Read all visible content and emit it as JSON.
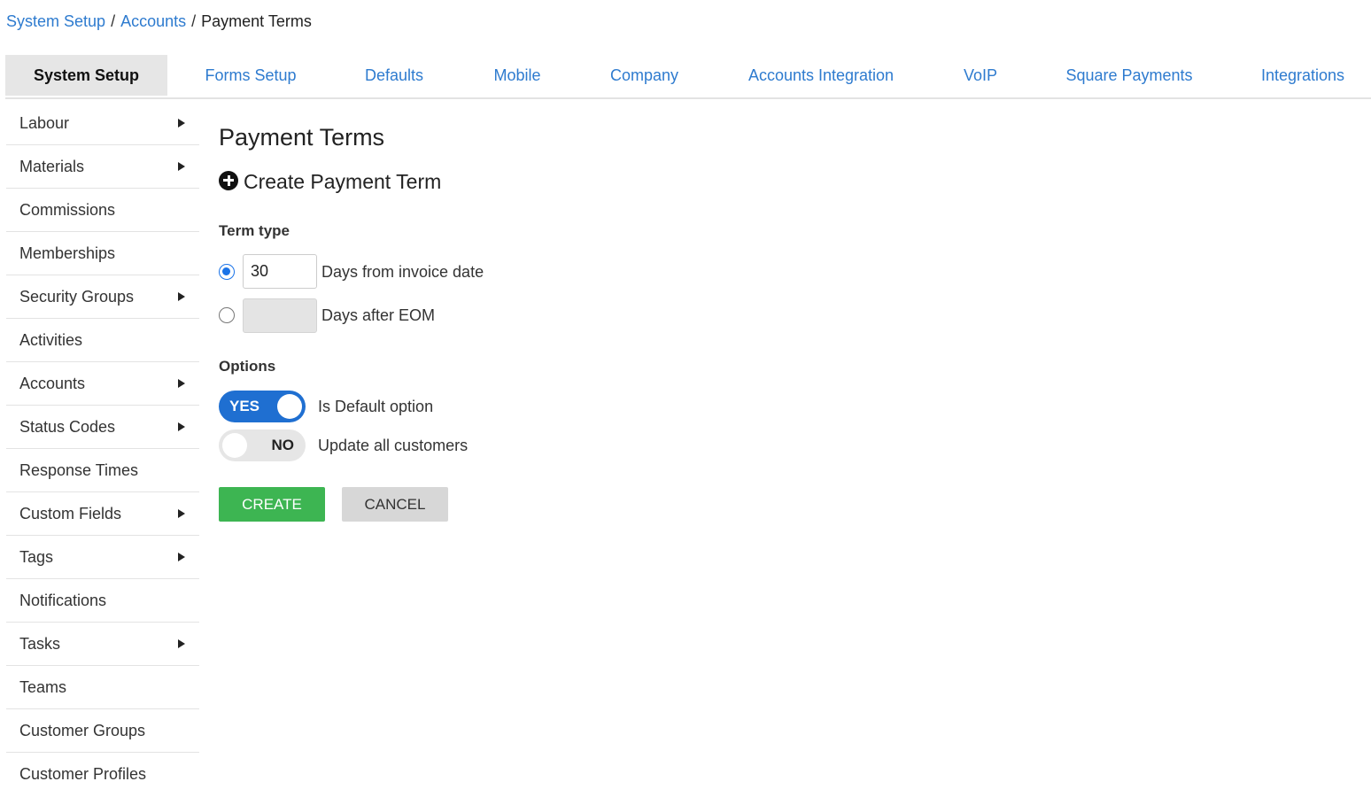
{
  "breadcrumb": {
    "items": [
      "System Setup",
      "Accounts"
    ],
    "separator": "/",
    "current": "Payment Terms"
  },
  "tabs": [
    {
      "label": "System Setup",
      "active": true
    },
    {
      "label": "Forms Setup"
    },
    {
      "label": "Defaults"
    },
    {
      "label": "Mobile"
    },
    {
      "label": "Company"
    },
    {
      "label": "Accounts Integration"
    },
    {
      "label": "VoIP"
    },
    {
      "label": "Square Payments"
    },
    {
      "label": "Integrations"
    }
  ],
  "sidebar": {
    "items": [
      {
        "label": "Labour",
        "has_submenu": true
      },
      {
        "label": "Materials",
        "has_submenu": true
      },
      {
        "label": "Commissions",
        "has_submenu": false
      },
      {
        "label": "Memberships",
        "has_submenu": false
      },
      {
        "label": "Security Groups",
        "has_submenu": true
      },
      {
        "label": "Activities",
        "has_submenu": false
      },
      {
        "label": "Accounts",
        "has_submenu": true
      },
      {
        "label": "Status Codes",
        "has_submenu": true
      },
      {
        "label": "Response Times",
        "has_submenu": false
      },
      {
        "label": "Custom Fields",
        "has_submenu": true
      },
      {
        "label": "Tags",
        "has_submenu": true
      },
      {
        "label": "Notifications",
        "has_submenu": false
      },
      {
        "label": "Tasks",
        "has_submenu": true
      },
      {
        "label": "Teams",
        "has_submenu": false
      },
      {
        "label": "Customer Groups",
        "has_submenu": false
      },
      {
        "label": "Customer Profiles",
        "has_submenu": false
      }
    ]
  },
  "main": {
    "title": "Payment Terms",
    "create_heading": "Create Payment Term",
    "term_type_label": "Term type",
    "term_options": [
      {
        "selected": true,
        "value": "30",
        "label": "Days from invoice date",
        "disabled": false
      },
      {
        "selected": false,
        "value": "",
        "label": "Days after EOM",
        "disabled": true
      }
    ],
    "options_label": "Options",
    "toggles": [
      {
        "state_label": "YES",
        "on": true,
        "label": "Is Default option"
      },
      {
        "state_label": "NO",
        "on": false,
        "label": "Update all customers"
      }
    ],
    "create_button": "CREATE",
    "cancel_button": "CANCEL"
  },
  "colors": {
    "link": "#2e7bcf",
    "toggle_on": "#1f6fd1",
    "create_button": "#3db552",
    "cancel_button": "#d7d7d7"
  }
}
